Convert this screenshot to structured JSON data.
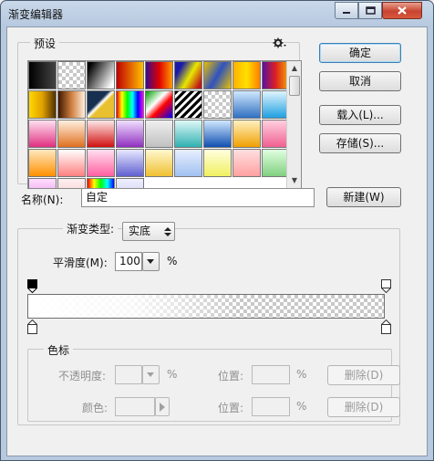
{
  "window": {
    "title": "渐变编辑器"
  },
  "presets": {
    "label": "预设",
    "swatches": [
      "linear-gradient(90deg,#000,#444)",
      "checker",
      "linear-gradient(120deg,#000 10%,#fff 90%)",
      "linear-gradient(90deg,#c00000,#ffc000)",
      "linear-gradient(90deg,#3a0a8a,#e00000,#ff9900)",
      "linear-gradient(120deg,#1a1aa8 20%,#e8e800 55%,#c01818 90%)",
      "linear-gradient(120deg,#e8c000,#2e52c0 50%,#e8c000)",
      "linear-gradient(90deg,#ffb000,#ffe000,#ff8000)",
      "linear-gradient(90deg,#5a10a0,#e02020,#f0b000)",
      "linear-gradient(90deg,#ffd800,#e0a000,#503000)",
      "linear-gradient(90deg,#401800,#d08040,#fff0e0)",
      "linear-gradient(135deg,#183050 40%,#fff 48%,#e8c030 56%)",
      "linear-gradient(90deg,#f00,#ff0,#0f0,#0ff,#00f,#f0f)",
      "linear-gradient(135deg,#00a000,#fff 40%,#ff0000 60%,#0000ff)",
      "repeating-linear-gradient(135deg,#000 0,#000 3px,#fff 3px,#fff 6px)",
      "checker",
      "linear-gradient(#d0e8ff,#3070c0)",
      "linear-gradient(#e0f4ff,#20a0e0)",
      "linear-gradient(#ffe0f0,#e03080)",
      "linear-gradient(#fff0e0,#e07020)",
      "linear-gradient(#ffe8e8,#d01010)",
      "linear-gradient(#f0e0ff,#9030c0)",
      "linear-gradient(#f0f0f0,#c0c0c0)",
      "linear-gradient(#e0f8f8,#30b0b0)",
      "linear-gradient(#d0e8ff,#1050b0)",
      "linear-gradient(#fff0c0,#f0a000)",
      "linear-gradient(#ffd0e0,#f06090)",
      "linear-gradient(#ffe8c0,#ff9000)",
      "linear-gradient(#fff,#ff8080)",
      "linear-gradient(#ffe0f0,#ff60a0)",
      "linear-gradient(#e8e8ff,#6060d0)",
      "linear-gradient(#fff8d0,#f0c030)",
      "linear-gradient(#e8f0ff,#a0c0f0)",
      "linear-gradient(#ffffe0,#f0f060)",
      "linear-gradient(#ffe0e0,#ffa0a0)",
      "linear-gradient(#e0ffe0,#80d080)",
      "linear-gradient(#ffe0ff,#e080e0)",
      "linear-gradient(#fff0f0,#f0c0c0)",
      "linear-gradient(90deg,#f00,#ff0,#0f0,#0ff,#00f)",
      "linear-gradient(#f0f0ff,#c0c0f0)"
    ]
  },
  "buttons": {
    "ok": "确定",
    "cancel": "取消",
    "load": "载入(L)...",
    "save": "存储(S)...",
    "new": "新建(W)"
  },
  "name": {
    "label": "名称(N):",
    "value": "自定"
  },
  "gradient": {
    "type_label": "渐变类型:",
    "type_value": "实底",
    "smoothness_label": "平滑度(M):",
    "smoothness_value": "100",
    "smoothness_unit": "%"
  },
  "stops": {
    "label": "色标",
    "opacity_label": "不透明度:",
    "opacity_unit": "%",
    "color_label": "颜色:",
    "location_label": "位置:",
    "location_unit": "%",
    "delete_label": "删除(D)"
  }
}
